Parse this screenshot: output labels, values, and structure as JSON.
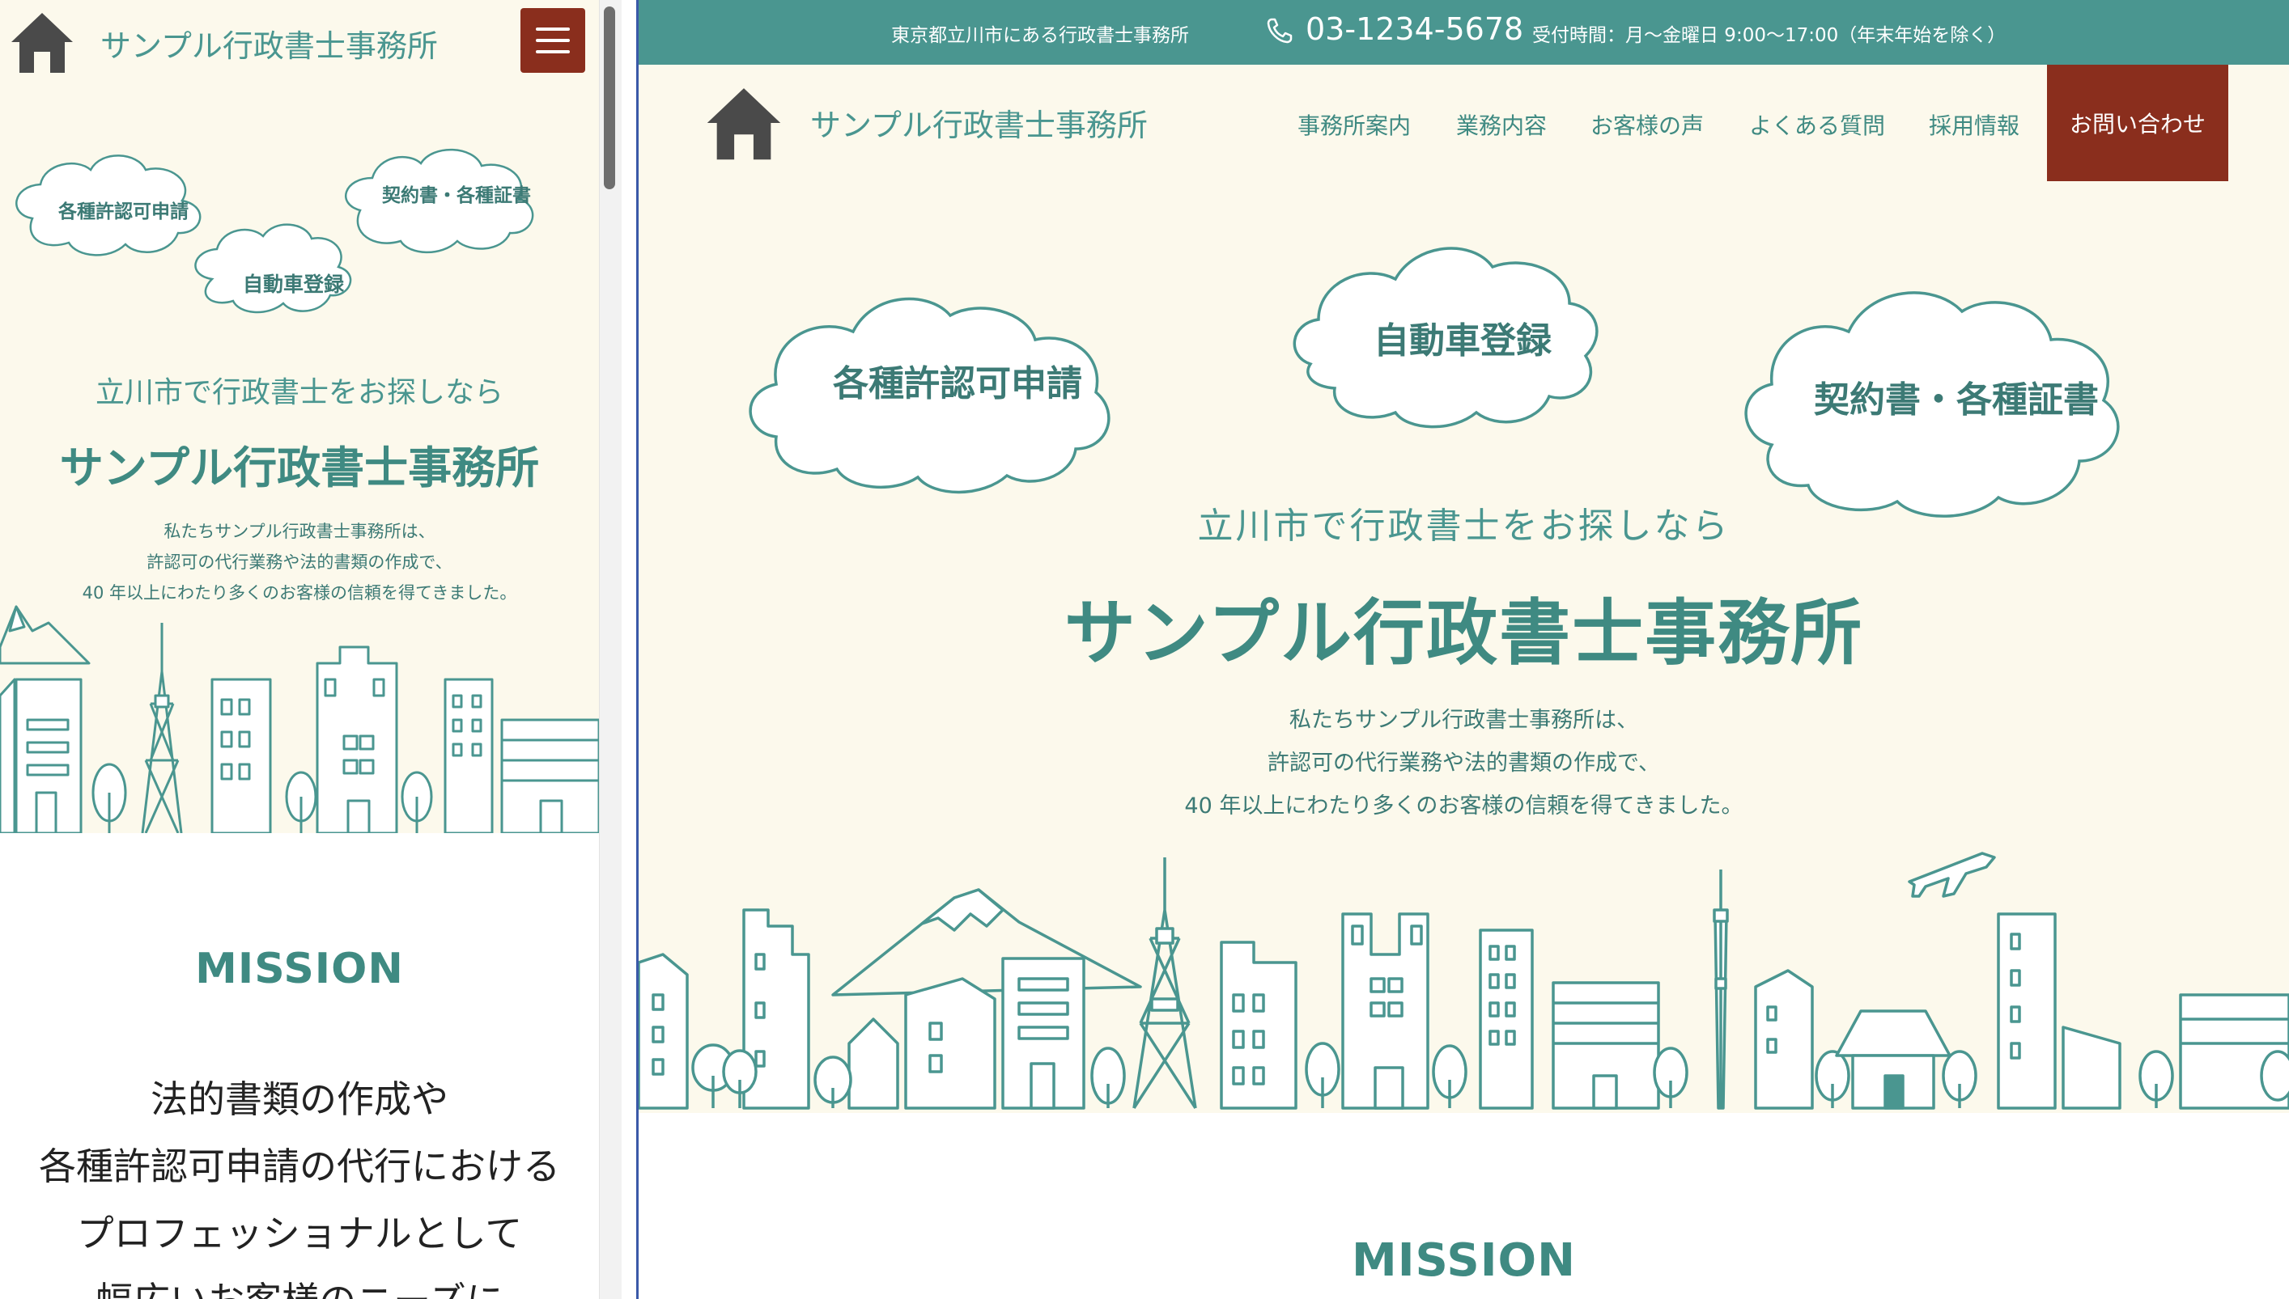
{
  "colors": {
    "teal": "#4a9690",
    "teal_dark": "#3f8a82",
    "cream": "#fcf9ec",
    "brick": "#8a2e1d",
    "divider_blue": "#3a59a8"
  },
  "mobile": {
    "header": {
      "logo_icon": "house-icon",
      "site_name": "サンプル行政書士事務所",
      "menu_icon": "hamburger-menu-icon"
    },
    "clouds": [
      "各種許認可申請",
      "自動車登録",
      "契約書・各種証書"
    ],
    "hero": {
      "catch": "立川市で行政書士をお探しなら",
      "title": "サンプル行政書士事務所",
      "desc": [
        "私たちサンプル行政書士事務所は、",
        "許認可の代行業務や法的書類の作成で、",
        "40 年以上にわたり多くのお客様の信頼を得てきました。"
      ]
    },
    "mission": {
      "heading": "MISSION",
      "body": [
        "法的書類の作成や",
        "各種許認可申請の代行における",
        "プロフェッショナルとして",
        "幅広いお客様のニーズに"
      ]
    }
  },
  "desktop": {
    "topbar": {
      "address": "東京都立川市にある行政書士事務所",
      "phone_icon": "phone-icon",
      "phone": "03-1234-5678",
      "hours": "受付時間：月〜金曜日 9:00〜17:00（年末年始を除く）"
    },
    "header": {
      "logo_icon": "house-icon",
      "site_name": "サンプル行政書士事務所",
      "nav": [
        "事務所案内",
        "業務内容",
        "お客様の声",
        "よくある質問",
        "採用情報"
      ],
      "contact": "お問い合わせ"
    },
    "clouds": [
      "各種許認可申請",
      "自動車登録",
      "契約書・各種証書"
    ],
    "hero": {
      "catch": "立川市で行政書士をお探しなら",
      "title": "サンプル行政書士事務所",
      "desc": [
        "私たちサンプル行政書士事務所は、",
        "許認可の代行業務や法的書類の作成で、",
        "40 年以上にわたり多くのお客様の信頼を得てきました。"
      ]
    },
    "mission": {
      "heading": "MISSION"
    }
  }
}
